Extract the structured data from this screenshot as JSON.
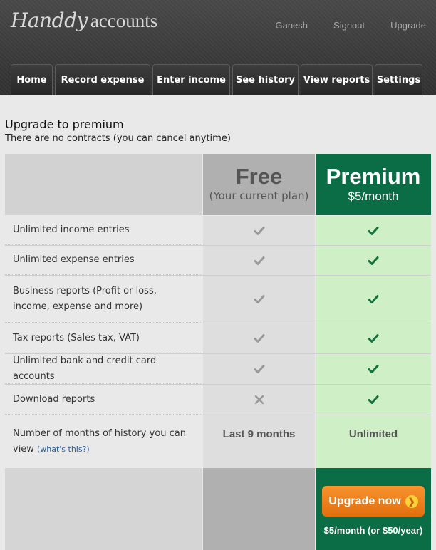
{
  "app": {
    "logo_script": "Handdy",
    "logo_rest": "accounts"
  },
  "top_links": [
    "Ganesh",
    "Signout",
    "Upgrade"
  ],
  "nav": [
    "Home",
    "Record expense",
    "Enter income",
    "See history",
    "View reports",
    "Settings"
  ],
  "intro": {
    "title": "Upgrade to premium",
    "subtitle": "There are no contracts (you can cancel anytime)"
  },
  "plans": {
    "free": {
      "name": "Free",
      "sub": "(Your current plan)"
    },
    "premium": {
      "name": "Premium",
      "sub": "$5/month"
    }
  },
  "features": [
    {
      "label": "Unlimited income entries",
      "free": "check",
      "premium": "check"
    },
    {
      "label": "Unlimited expense entries",
      "free": "check",
      "premium": "check"
    },
    {
      "label": "Business reports (Profit or loss, income, expense and more)",
      "free": "check",
      "premium": "check"
    },
    {
      "label": "Tax reports (Sales tax, VAT)",
      "free": "check",
      "premium": "check"
    },
    {
      "label": "Unlimited bank and credit card accounts",
      "free": "check",
      "premium": "check"
    },
    {
      "label": "Download reports",
      "free": "cross",
      "premium": "check"
    },
    {
      "label": "Number of months of history you can view",
      "link": "(what's this?)",
      "free": "Last 9 months",
      "premium": "Unlimited"
    }
  ],
  "cta": {
    "button": "Upgrade now",
    "price_note": "$5/month (or $50/year)"
  },
  "colors": {
    "premium_green": "#0b6d46",
    "premium_cell": "#cff0c6",
    "button_orange": "#f08020"
  }
}
